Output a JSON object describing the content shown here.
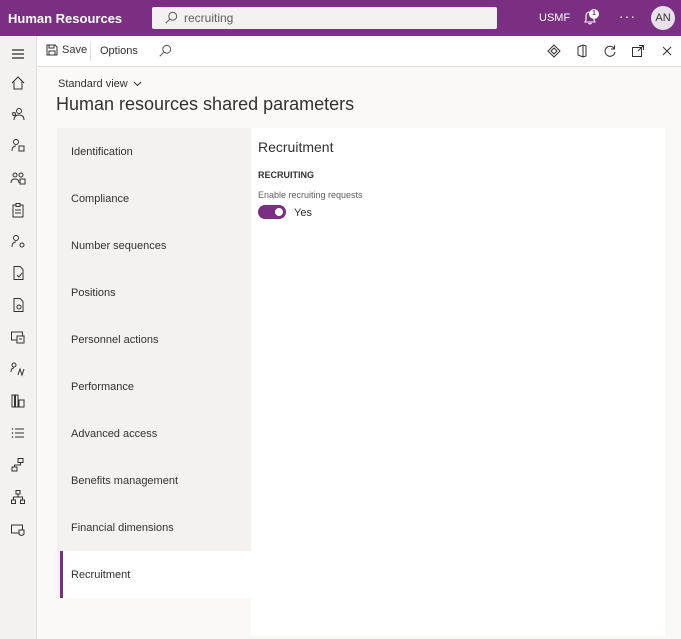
{
  "app": {
    "title": "Human Resources",
    "company": "USMF",
    "notification_count": "1",
    "user_initials": "AN"
  },
  "search": {
    "value": "recruiting"
  },
  "actionbar": {
    "save_label": "Save",
    "options_label": "Options"
  },
  "header": {
    "view_label": "Standard view",
    "page_title": "Human resources shared parameters"
  },
  "nav": {
    "items": [
      {
        "label": "Identification"
      },
      {
        "label": "Compliance"
      },
      {
        "label": "Number sequences"
      },
      {
        "label": "Positions"
      },
      {
        "label": "Personnel actions"
      },
      {
        "label": "Performance"
      },
      {
        "label": "Advanced access"
      },
      {
        "label": "Benefits management"
      },
      {
        "label": "Financial dimensions"
      },
      {
        "label": "Recruitment"
      }
    ],
    "active": "Recruitment"
  },
  "section": {
    "title": "Recruitment",
    "group_title": "RECRUITING",
    "field_label": "Enable recruiting requests",
    "toggle_state": "Yes"
  },
  "colors": {
    "brand": "#7b2f83"
  },
  "icons": {
    "rail": [
      "hamburger-icon",
      "home-icon",
      "people-icon",
      "person-key-icon",
      "people-group-icon",
      "clipboard-icon",
      "person-gear-icon",
      "document-icon",
      "document-gear-icon",
      "screen-icon",
      "people-scale-icon",
      "library-icon",
      "list-icon",
      "org-chart-icon",
      "hierarchy-icon",
      "shield-icon"
    ]
  }
}
